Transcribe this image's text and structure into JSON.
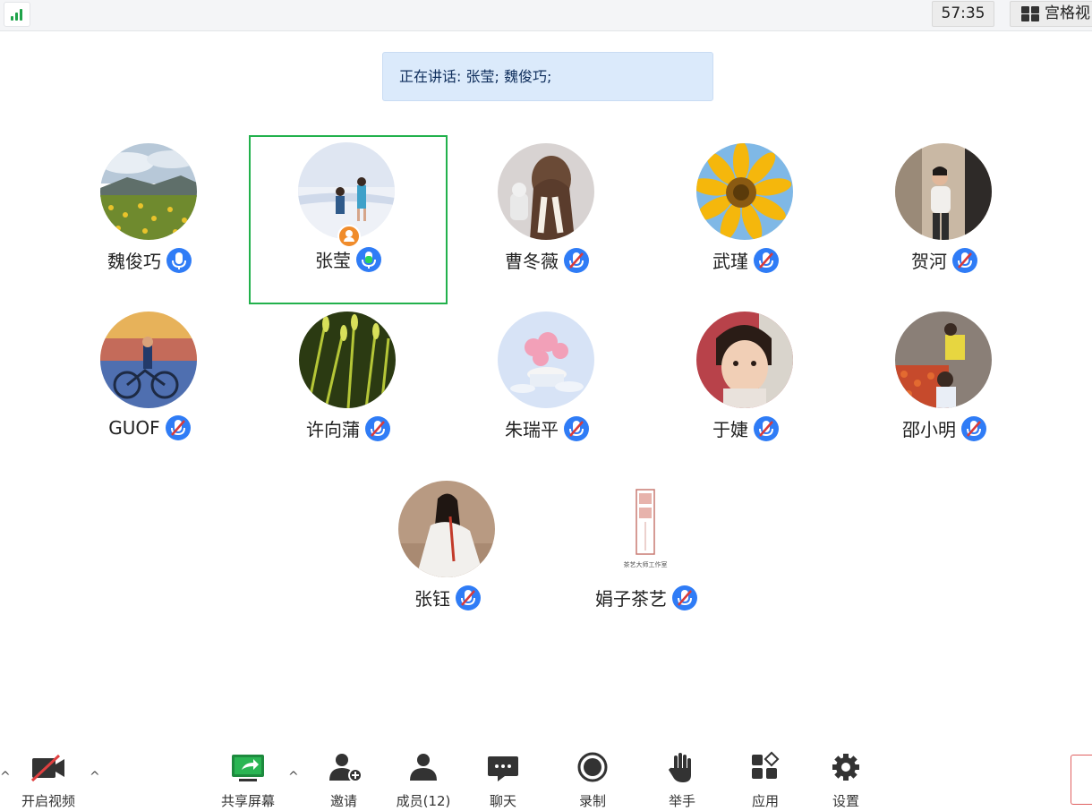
{
  "topbar": {
    "timer": "57:35",
    "grid_view_label": "宫格视"
  },
  "speaking_banner": "正在讲话: 张莹; 魏俊巧;",
  "participants": [
    {
      "name": "魏俊巧",
      "mic": "active-blue"
    },
    {
      "name": "张莹",
      "mic": "speaking-green",
      "host": true,
      "selected": true
    },
    {
      "name": "曹冬薇",
      "mic": "muted"
    },
    {
      "name": "武瑾",
      "mic": "muted"
    },
    {
      "name": "贺河",
      "mic": "muted"
    },
    {
      "name": "GUOF",
      "mic": "muted"
    },
    {
      "name": "许向蒲",
      "mic": "muted"
    },
    {
      "name": "朱瑞平",
      "mic": "muted"
    },
    {
      "name": "于婕",
      "mic": "muted"
    },
    {
      "name": "邵小明",
      "mic": "muted"
    },
    {
      "name": "张钰",
      "mic": "muted"
    },
    {
      "name": "娟子茶艺",
      "mic": "muted"
    }
  ],
  "toolbar": {
    "video": "开启视频",
    "share": "共享屏幕",
    "invite": "邀请",
    "members": "成员(12)",
    "chat": "聊天",
    "record": "录制",
    "raise_hand": "举手",
    "apps": "应用",
    "settings": "设置"
  },
  "colors": {
    "accent_blue": "#2f7cf6",
    "speaking_green": "#22b14c",
    "host_badge": "#f08c2b",
    "banner_bg": "#dbeafb"
  },
  "seal_text": "茶艺大师工作室"
}
